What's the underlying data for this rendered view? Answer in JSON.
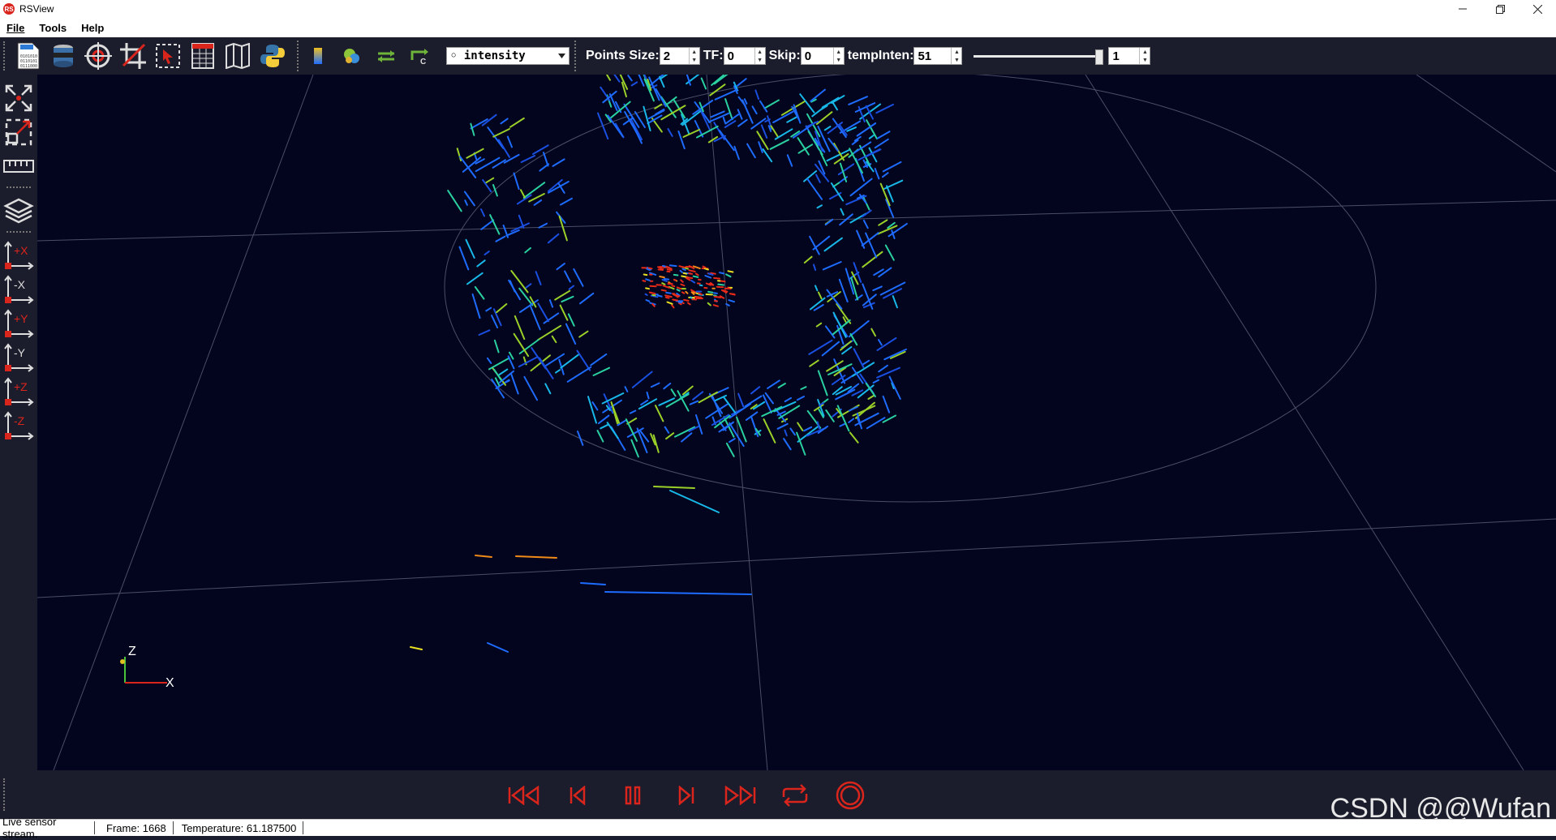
{
  "window": {
    "title": "RSView",
    "app_icon_text": "RS",
    "minimize_icon": "minimize-icon",
    "maximize_icon": "restore-icon",
    "close_icon": "close-icon"
  },
  "menu": {
    "items": [
      {
        "label": "File"
      },
      {
        "label": "Tools"
      },
      {
        "label": "Help"
      }
    ]
  },
  "toolbar": {
    "icons": [
      "open-file-icon",
      "sensor-stream-icon",
      "target-icon",
      "crop-icon",
      "select-points-icon",
      "spreadsheet-icon",
      "map-icon",
      "python-icon",
      "color-legend-icon",
      "color-scalar-icon",
      "distance-icon",
      "transform-icon"
    ],
    "color_by": "intensity",
    "points_size_label": "Points Size:",
    "points_size_value": "2",
    "tf_label": "TF:",
    "tf_value": "0",
    "skip_label": "Skip:",
    "skip_value": "0",
    "temp_inten_label": "tempInten:",
    "temp_inten_value": "51",
    "slider_level": 1.0,
    "slider_value": "1"
  },
  "left_toolbar": {
    "icons": [
      "reset-camera-icon",
      "zoom-to-box-icon",
      "ruler-icon",
      "layers-icon",
      "view-plus-x-icon",
      "view-minus-x-icon",
      "view-plus-y-icon",
      "view-minus-y-icon",
      "view-plus-z-icon",
      "view-minus-z-icon"
    ],
    "axis_labels": [
      "+X",
      "-X",
      "+Y",
      "-Y",
      "+Z",
      "-Z"
    ]
  },
  "viewport": {
    "axes_labels": {
      "z": "Z",
      "x": "X"
    }
  },
  "playback": {
    "icons": [
      "first-frame-icon",
      "previous-frame-icon",
      "pause-icon",
      "next-frame-icon",
      "last-frame-icon",
      "loop-icon",
      "record-icon"
    ]
  },
  "watermark": "CSDN @@Wufan",
  "status": {
    "stream": "Live sensor stream.",
    "frame": "Frame: 1668",
    "temperature": "Temperature: 61.187500"
  },
  "colors": {
    "background": "#03051f",
    "panel": "#1b1d2c",
    "record": "#d9251c",
    "accent_blue": "#1e6cff"
  }
}
